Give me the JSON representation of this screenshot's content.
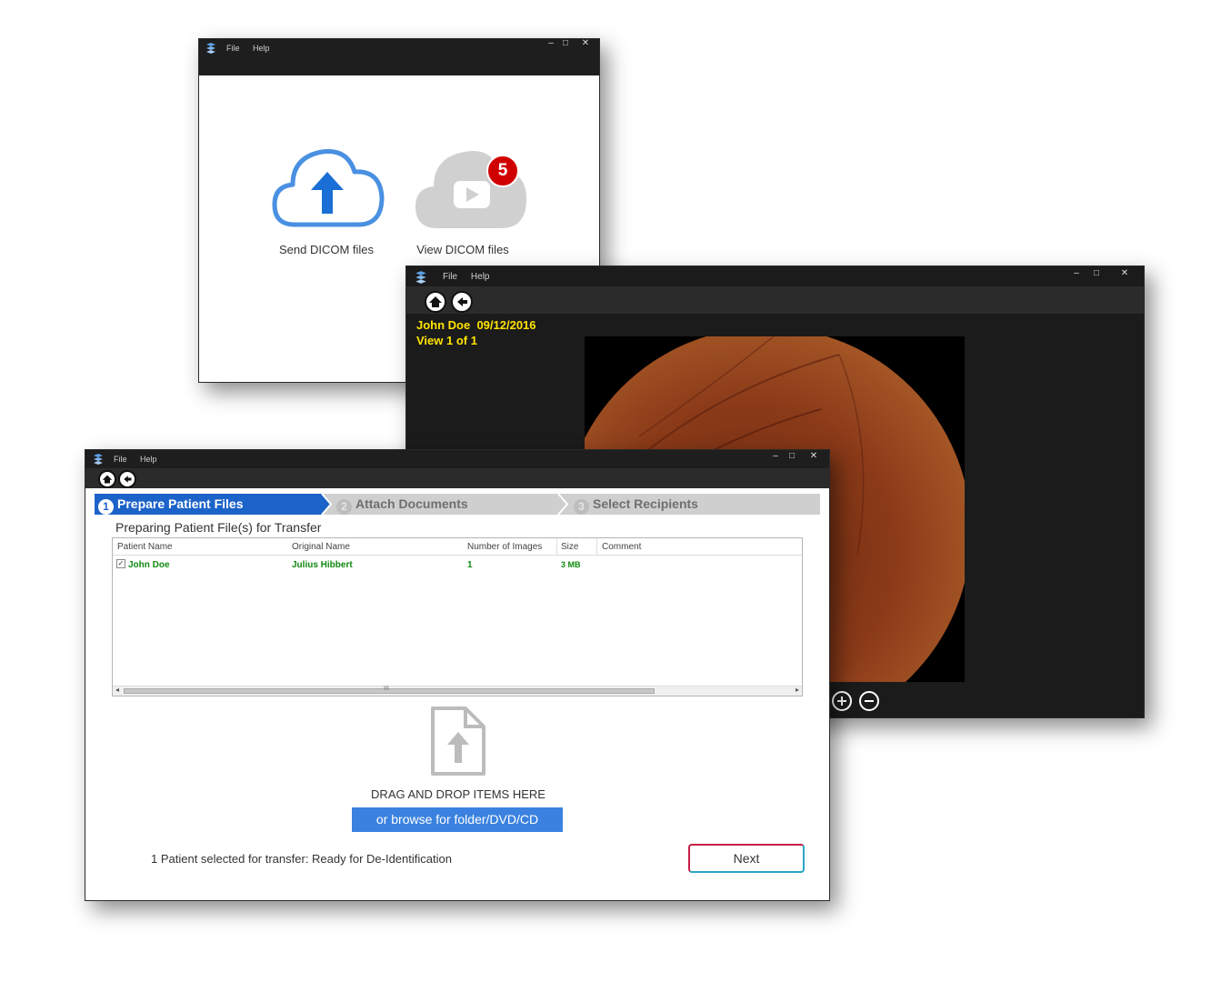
{
  "common": {
    "menu_file": "File",
    "menu_help": "Help",
    "minimize": "–",
    "maximize": "□",
    "close": "✕"
  },
  "home_window": {
    "send_label": "Send DICOM files",
    "view_label": "View DICOM files",
    "view_badge": "5",
    "colors": {
      "send_accent": "#1a6fd6",
      "cloud_outline": "#4a90e2",
      "badge": "#d10000",
      "view_cloud": "#d0d0d0"
    }
  },
  "viewer_window": {
    "patient_line": "John Doe  09/12/2016",
    "view_line": "View 1 of 1",
    "overlay_color": "#ffe400",
    "zoom_in_icon": "plus-circle-icon",
    "zoom_out_icon": "minus-circle-icon"
  },
  "transfer_window": {
    "steps": [
      {
        "num": "1",
        "label": "Prepare Patient Files",
        "active": true
      },
      {
        "num": "2",
        "label": "Attach Documents",
        "active": false
      },
      {
        "num": "3",
        "label": "Select Recipients",
        "active": false
      }
    ],
    "section_title": "Preparing Patient File(s) for Transfer",
    "table": {
      "headers": [
        "Patient Name",
        "Original Name",
        "Number of Images",
        "Size",
        "Comment"
      ],
      "rows": [
        {
          "checked": true,
          "patient_name": "John Doe",
          "original_name": "Julius Hibbert",
          "images": "1",
          "size": "3 MB",
          "comment": ""
        }
      ],
      "scroll_grip": "III",
      "scroll_left": "◂",
      "scroll_right": "▸"
    },
    "drop_text": "DRAG AND DROP ITEMS HERE",
    "browse_label": "or browse for folder/DVD/CD",
    "status_text": "1 Patient selected for transfer: Ready for De-Identification",
    "next_label": "Next",
    "colors": {
      "active_step": "#1c63c9",
      "inactive_step": "#cfcfcf",
      "browse": "#3b82e0",
      "row_text": "#108a10"
    }
  }
}
